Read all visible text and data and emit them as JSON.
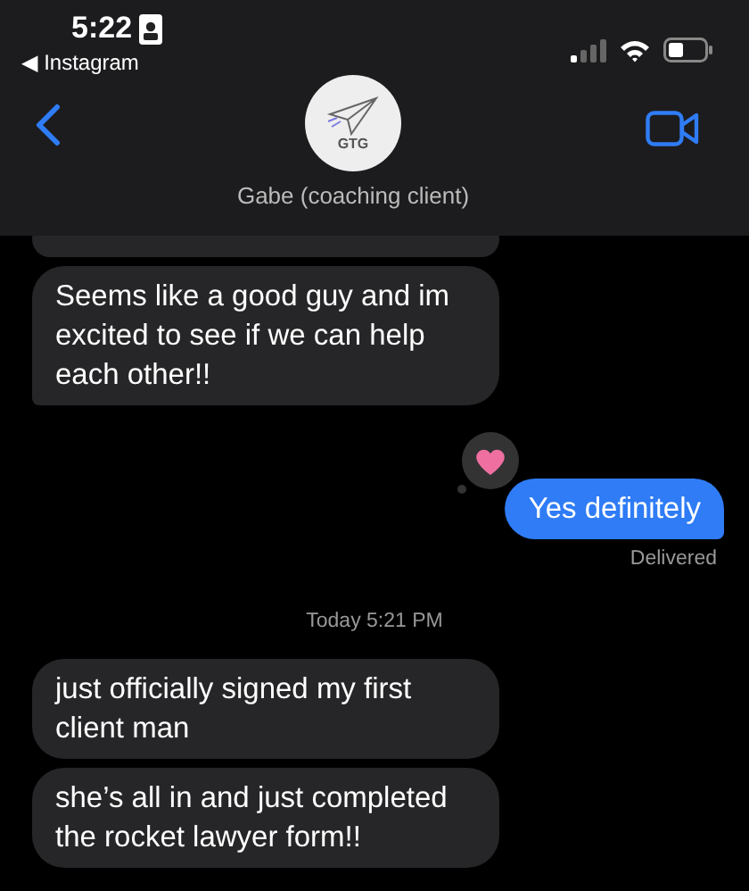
{
  "status_bar": {
    "time": "5:22",
    "back_app": "◀ Instagram"
  },
  "header": {
    "avatar_text": "GTG",
    "contact_name": "Gabe (coaching client)"
  },
  "messages": [
    {
      "kind": "received",
      "tail": false,
      "partial": true
    },
    {
      "kind": "received",
      "text": "Seems like a good guy and im excited to see if we can help each other!!",
      "tail": true
    },
    {
      "kind": "sent",
      "text": "Yes definitely",
      "tail": true,
      "tapback": true,
      "status": "Delivered"
    },
    {
      "kind": "timestamp",
      "day": "Today",
      "time": "5:21 PM"
    },
    {
      "kind": "received",
      "text": "just officially signed my first client man",
      "tail": false
    },
    {
      "kind": "received",
      "text": "she’s all in and just completed the rocket lawyer form!!",
      "tail": false
    }
  ]
}
